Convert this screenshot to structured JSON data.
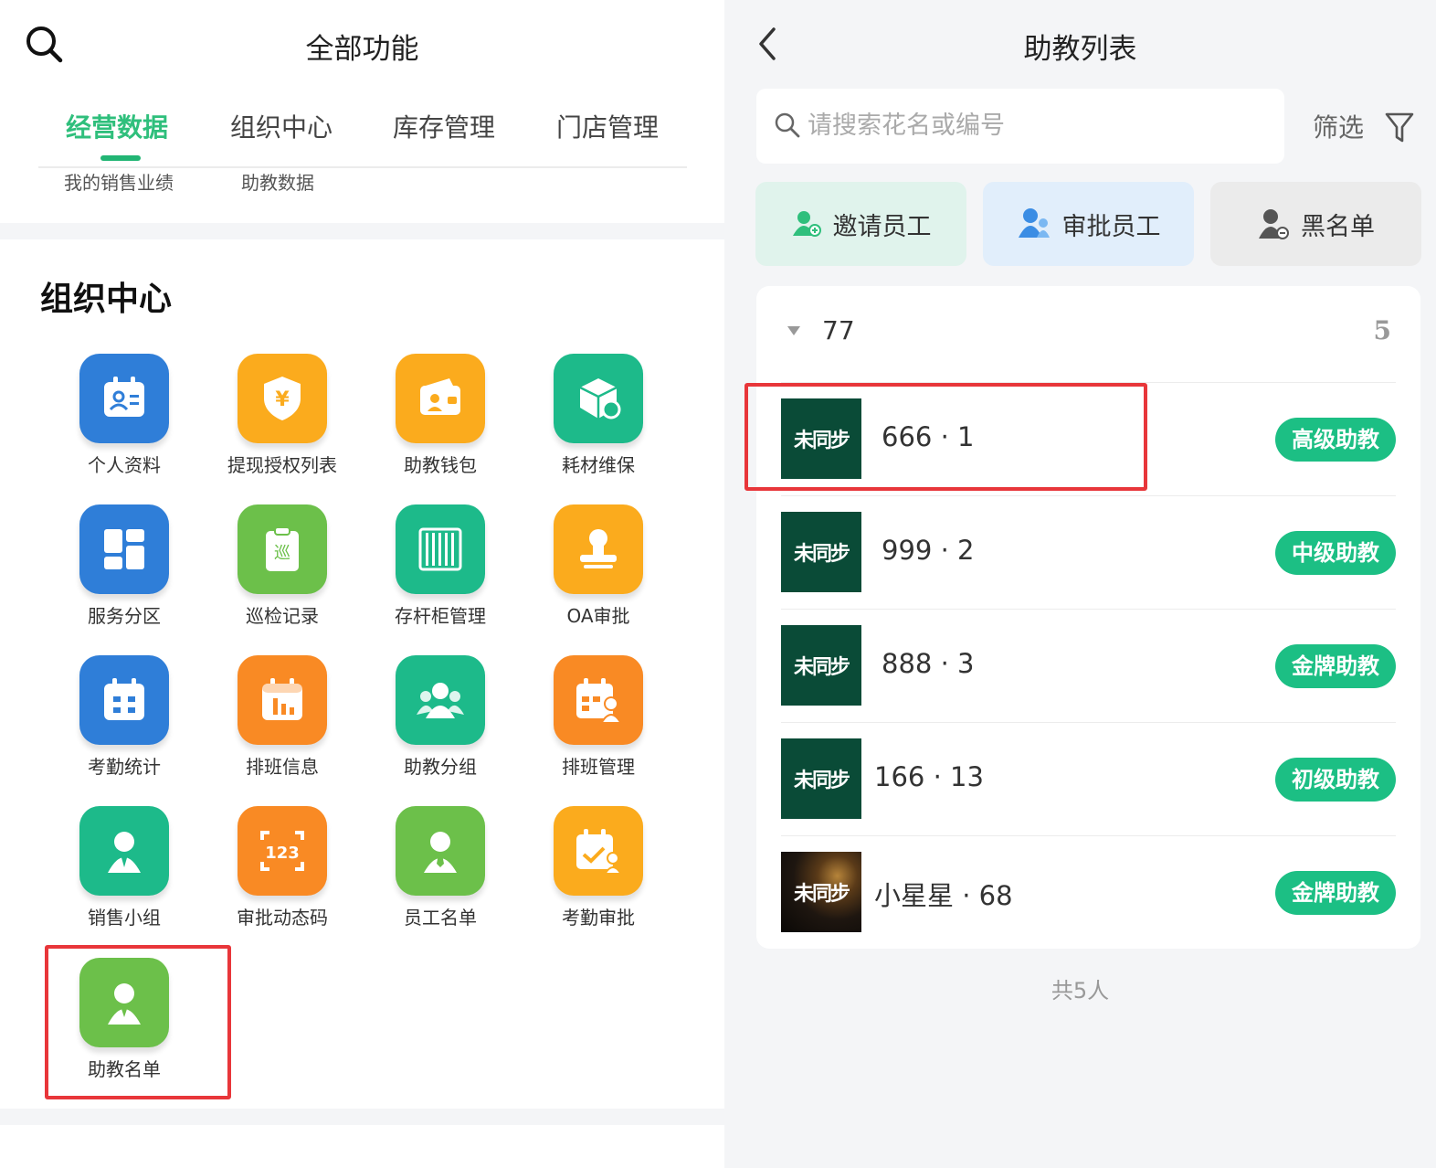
{
  "left": {
    "title": "全部功能",
    "tabs": [
      "经营数据",
      "组织中心",
      "库存管理",
      "门店管理"
    ],
    "active_tab": "经营数据",
    "sub_items": [
      "我的销售业绩",
      "助教数据"
    ],
    "section_title": "组织中心",
    "tiles": [
      {
        "label": "个人资料",
        "color": "#2f7ed8",
        "icon": "profile-card-icon"
      },
      {
        "label": "提现授权列表",
        "color": "#fbab1d",
        "icon": "yuan-shield-icon"
      },
      {
        "label": "助教钱包",
        "color": "#fbab1d",
        "icon": "wallet-icon"
      },
      {
        "label": "耗材维保",
        "color": "#1dba8a",
        "icon": "box-wrench-icon"
      },
      {
        "label": "服务分区",
        "color": "#2f7ed8",
        "icon": "grid-blocks-icon"
      },
      {
        "label": "巡检记录",
        "color": "#6cc04a",
        "icon": "clipboard-icon"
      },
      {
        "label": "存杆柜管理",
        "color": "#1dba8a",
        "icon": "cue-cabinet-icon"
      },
      {
        "label": "OA审批",
        "color": "#fbab1d",
        "icon": "stamp-icon"
      },
      {
        "label": "考勤统计",
        "color": "#2f7ed8",
        "icon": "calendar-check-icon"
      },
      {
        "label": "排班信息",
        "color": "#f98a24",
        "icon": "calendar-chart-icon"
      },
      {
        "label": "助教分组",
        "color": "#1dba8a",
        "icon": "group-icon"
      },
      {
        "label": "排班管理",
        "color": "#f98a24",
        "icon": "calendar-person-icon"
      },
      {
        "label": "销售小组",
        "color": "#1dba8a",
        "icon": "salesperson-icon"
      },
      {
        "label": "审批动态码",
        "color": "#f98a24",
        "icon": "code-123-icon"
      },
      {
        "label": "员工名单",
        "color": "#6cc04a",
        "icon": "employee-icon"
      },
      {
        "label": "考勤审批",
        "color": "#fbab1d",
        "icon": "calendar-approve-icon"
      },
      {
        "label": "助教名单",
        "color": "#6cc04a",
        "icon": "assistant-icon"
      }
    ]
  },
  "right": {
    "title": "助教列表",
    "search_placeholder": "请搜索花名或编号",
    "filter_label": "筛选",
    "actions": {
      "invite": "邀请员工",
      "approve": "审批员工",
      "blacklist": "黑名单"
    },
    "group": {
      "name": "77",
      "count": "5"
    },
    "rows": [
      {
        "avatar_text": "未同步",
        "name": "666 · 1",
        "level": "高级助教"
      },
      {
        "avatar_text": "未同步",
        "name": "999 · 2",
        "level": "中级助教"
      },
      {
        "avatar_text": "未同步",
        "name": "888 · 3",
        "level": "金牌助教"
      },
      {
        "avatar_text": "未同步",
        "name": "166 · 13",
        "level": "初级助教"
      },
      {
        "avatar_text": "未同步",
        "name": "小星星 · 68",
        "level": "金牌助教"
      }
    ],
    "total": "共5人"
  },
  "colors": {
    "brand_green": "#22b574",
    "badge_green": "#1cbf84",
    "highlight_red": "#e8363a"
  }
}
